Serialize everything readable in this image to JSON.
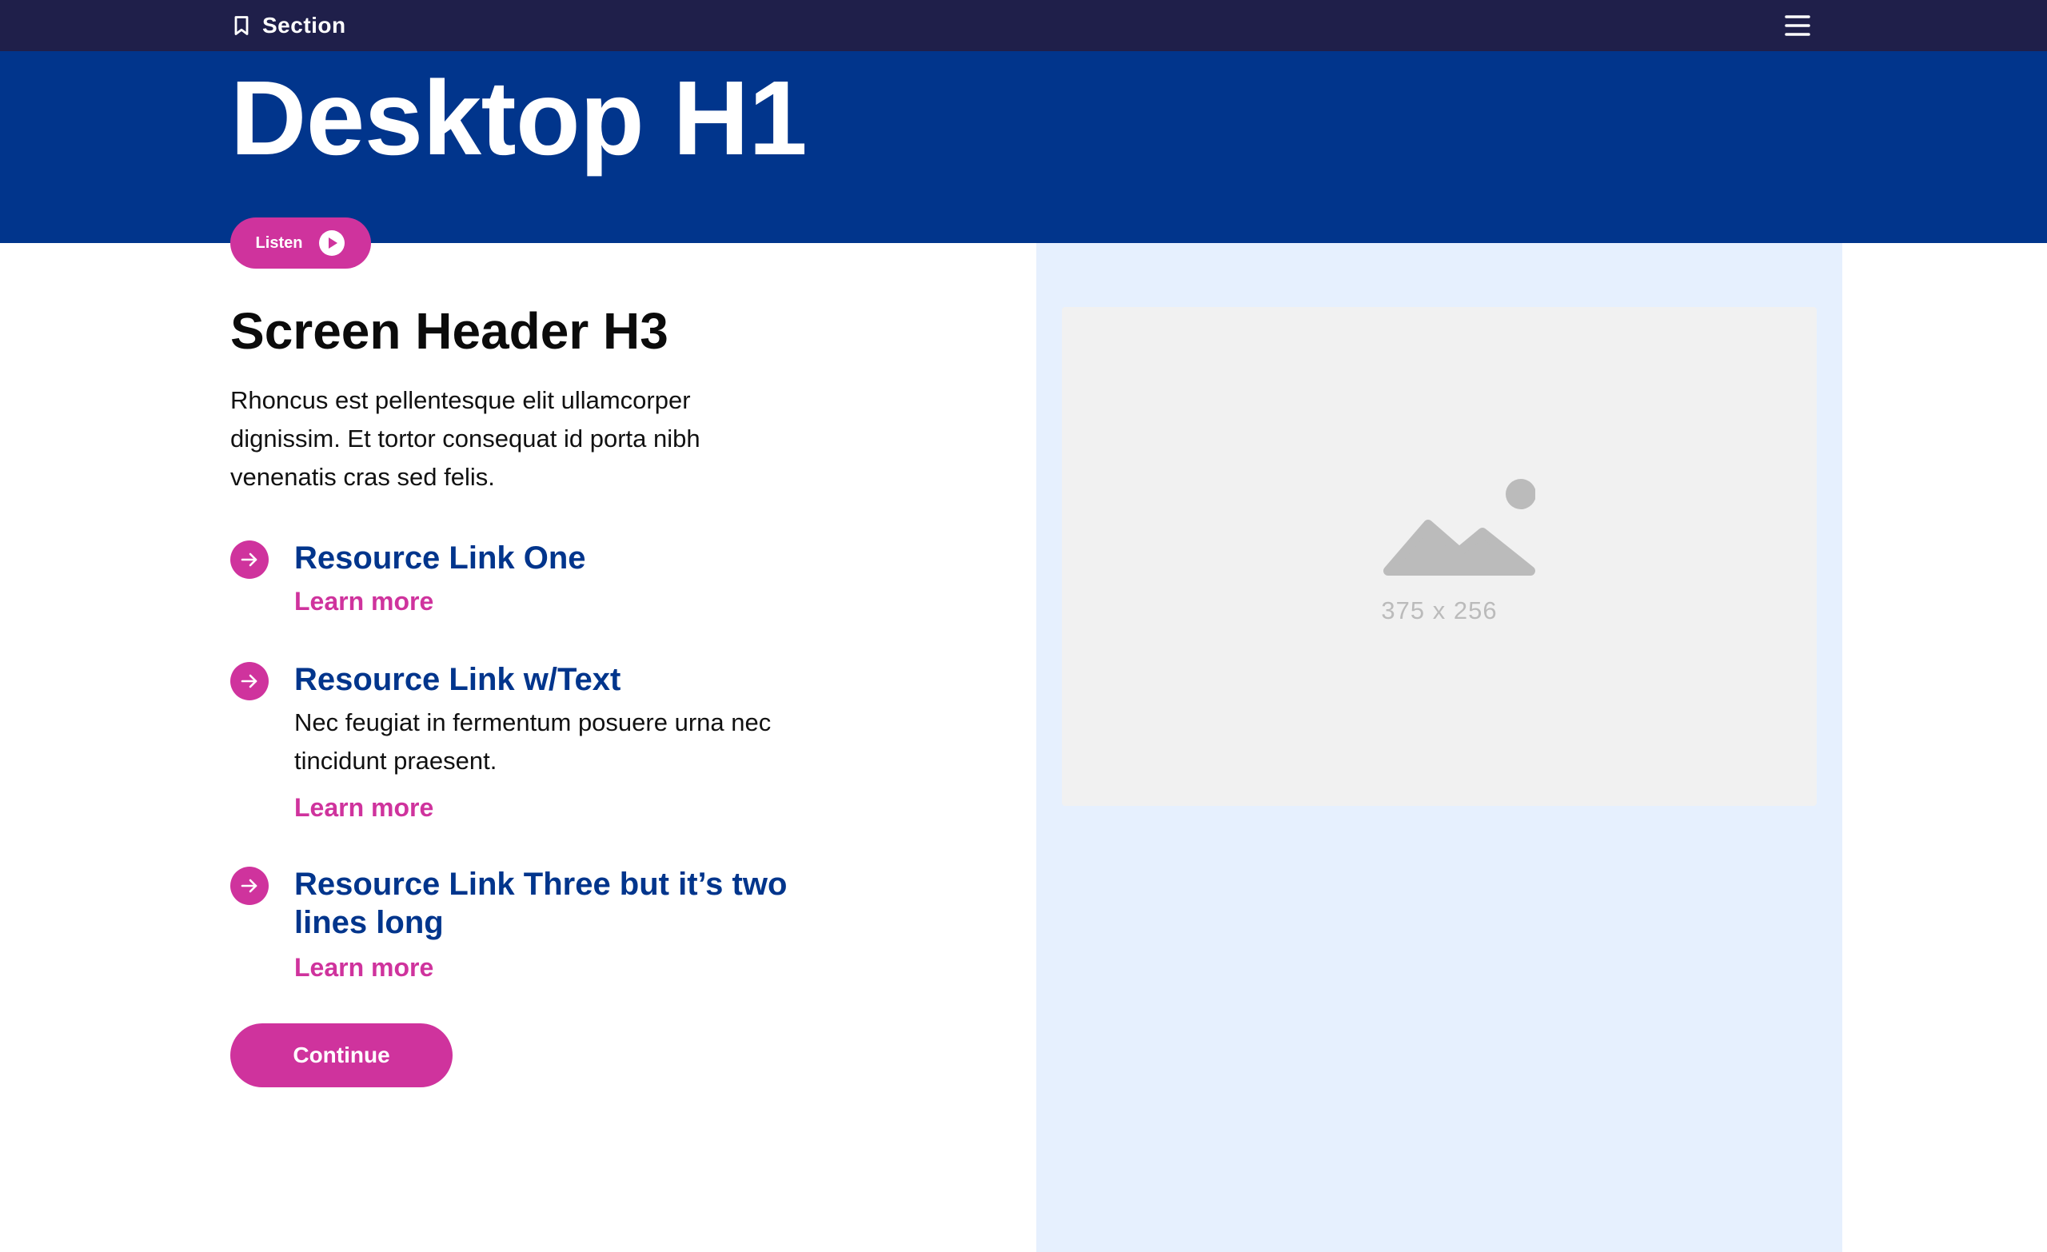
{
  "topbar": {
    "section_label": "Section",
    "section_icon": "bookmark-icon",
    "menu_icon": "hamburger-menu-icon"
  },
  "hero": {
    "title": "Desktop H1"
  },
  "listen": {
    "label": "Listen",
    "icon": "play-icon"
  },
  "main": {
    "header": "Screen Header H3",
    "intro": "Rhoncus est pellentesque elit ullamcorper dignissim. Et tortor consequat id porta nibh venenatis cras sed felis.",
    "resources": [
      {
        "title": "Resource Link One",
        "text": "",
        "link": "Learn more"
      },
      {
        "title": "Resource Link w/Text",
        "text": "Nec feugiat in fermentum posuere urna nec tincidunt praesent.",
        "link": "Learn more"
      },
      {
        "title": "Resource Link Three but it’s two lines long",
        "text": "",
        "link": "Learn more"
      }
    ],
    "continue_label": "Continue"
  },
  "image_placeholder": {
    "label": "375 x 256",
    "icon": "image-placeholder-icon"
  },
  "colors": {
    "topbar": "#1f1f4a",
    "hero": "#01358c",
    "accent": "#cf339d",
    "link": "#01358c",
    "side_panel": "#e6f0fe",
    "placeholder": "#f1f1f1"
  }
}
